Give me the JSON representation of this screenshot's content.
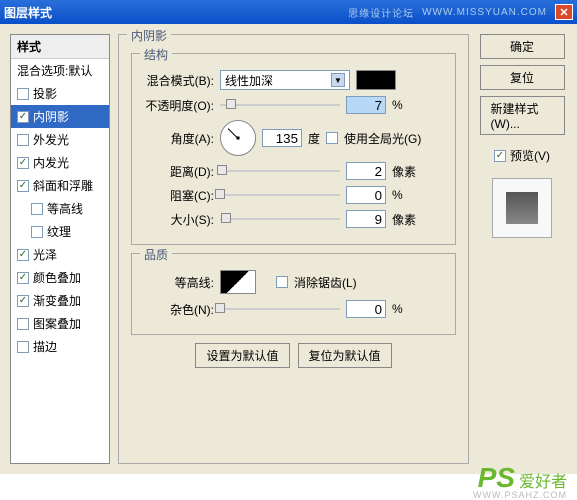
{
  "titlebar": {
    "title": "图层样式",
    "watermark": "思缘设计论坛",
    "url": "WWW.MISSYUAN.COM"
  },
  "styleList": {
    "header": "样式",
    "items": [
      {
        "label": "混合选项:默认",
        "checked": null,
        "selected": false,
        "indent": false
      },
      {
        "label": "投影",
        "checked": false,
        "selected": false,
        "indent": false
      },
      {
        "label": "内阴影",
        "checked": true,
        "selected": true,
        "indent": false
      },
      {
        "label": "外发光",
        "checked": false,
        "selected": false,
        "indent": false
      },
      {
        "label": "内发光",
        "checked": true,
        "selected": false,
        "indent": false
      },
      {
        "label": "斜面和浮雕",
        "checked": true,
        "selected": false,
        "indent": false
      },
      {
        "label": "等高线",
        "checked": false,
        "selected": false,
        "indent": true
      },
      {
        "label": "纹理",
        "checked": false,
        "selected": false,
        "indent": true
      },
      {
        "label": "光泽",
        "checked": true,
        "selected": false,
        "indent": false
      },
      {
        "label": "颜色叠加",
        "checked": true,
        "selected": false,
        "indent": false
      },
      {
        "label": "渐变叠加",
        "checked": true,
        "selected": false,
        "indent": false
      },
      {
        "label": "图案叠加",
        "checked": false,
        "selected": false,
        "indent": false
      },
      {
        "label": "描边",
        "checked": false,
        "selected": false,
        "indent": false
      }
    ]
  },
  "panel": {
    "title": "内阴影",
    "structure": {
      "title": "结构",
      "blendModeLabel": "混合模式(B):",
      "blendModeValue": "线性加深",
      "opacityLabel": "不透明度(O):",
      "opacityValue": "7",
      "opacityUnit": "%",
      "angleLabel": "角度(A):",
      "angleValue": "135",
      "angleUnit": "度",
      "globalLightLabel": "使用全局光(G)",
      "globalLightChecked": false,
      "distanceLabel": "距离(D):",
      "distanceValue": "2",
      "distanceUnit": "像素",
      "chokeLabel": "阻塞(C):",
      "chokeValue": "0",
      "chokeUnit": "%",
      "sizeLabel": "大小(S):",
      "sizeValue": "9",
      "sizeUnit": "像素"
    },
    "quality": {
      "title": "品质",
      "contourLabel": "等高线:",
      "antiAliasLabel": "消除锯齿(L)",
      "antiAliasChecked": false,
      "noiseLabel": "杂色(N):",
      "noiseValue": "0",
      "noiseUnit": "%"
    },
    "buttons": {
      "setDefault": "设置为默认值",
      "resetDefault": "复位为默认值"
    }
  },
  "rightPanel": {
    "ok": "确定",
    "cancel": "复位",
    "newStyle": "新建样式(W)...",
    "preview": "预览(V)",
    "previewChecked": true
  },
  "footer": {
    "logo": "PS",
    "text": "爱好者",
    "url": "WWW.PSAHZ.COM"
  }
}
